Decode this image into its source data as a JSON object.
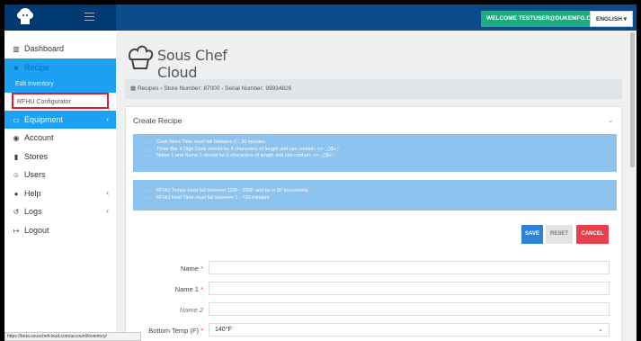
{
  "topbar": {
    "welcome": "WELCOME TESTUSER@DUKEMFG.COM!",
    "language": "ENGLISH"
  },
  "sidebar": {
    "items": [
      {
        "label": "Dashboard",
        "icon": "bar-chart-icon"
      },
      {
        "label": "Recipe",
        "icon": "book-icon"
      },
      {
        "label": "Edit Inventory"
      },
      {
        "label": "RFHU Configurator"
      },
      {
        "label": "Equipment",
        "icon": "monitor-icon"
      },
      {
        "label": "Account",
        "icon": "user-circle-icon"
      },
      {
        "label": "Stores",
        "icon": "store-icon"
      },
      {
        "label": "Users",
        "icon": "users-icon"
      },
      {
        "label": "Help",
        "icon": "help-icon"
      },
      {
        "label": "Logs",
        "icon": "history-icon"
      },
      {
        "label": "Logout",
        "icon": "logout-icon"
      }
    ]
  },
  "brand": {
    "name": "Sous Chef Cloud"
  },
  "breadcrumb": {
    "root": "Recipes",
    "current": "Store Number: 87000 - Serial Number: 99934826"
  },
  "card": {
    "title": "Create Recipe",
    "info1": [
      "Cook More Time must fall between 0 - 30 minutes",
      "Timer Bar 4 Digit Code should be 4 characters of length and can contain: <>-_()$+;'",
      "Name 1 and Name 2 should be 6 characters of length and can contain: <>-_()$+;'"
    ],
    "info2": [
      "RFHU Temps must fall between 110F - 200F and be in 5F increments",
      "RFHU Hold Time must fall between 1 - 720 minutes"
    ]
  },
  "buttons": {
    "save": "SAVE",
    "reset": "RESET",
    "cancel": "CANCEL"
  },
  "form": {
    "name_label": "Name",
    "name1_label": "Name 1",
    "name2_label": "Name 2",
    "bottom_temp_label": "Bottom Temp (F)",
    "bottom_temp_value": "140°F",
    "required_mark": "*"
  },
  "statusbar": {
    "url": "https://beta.souschefcloud.com/account/inventory/"
  },
  "colors": {
    "topbar": "#0b4a8b",
    "accent": "#1da1f2",
    "welcome_button": "#1eaa83",
    "save": "#2a83d8",
    "cancel": "#e8404a",
    "info_panel": "#8cc3ef"
  }
}
